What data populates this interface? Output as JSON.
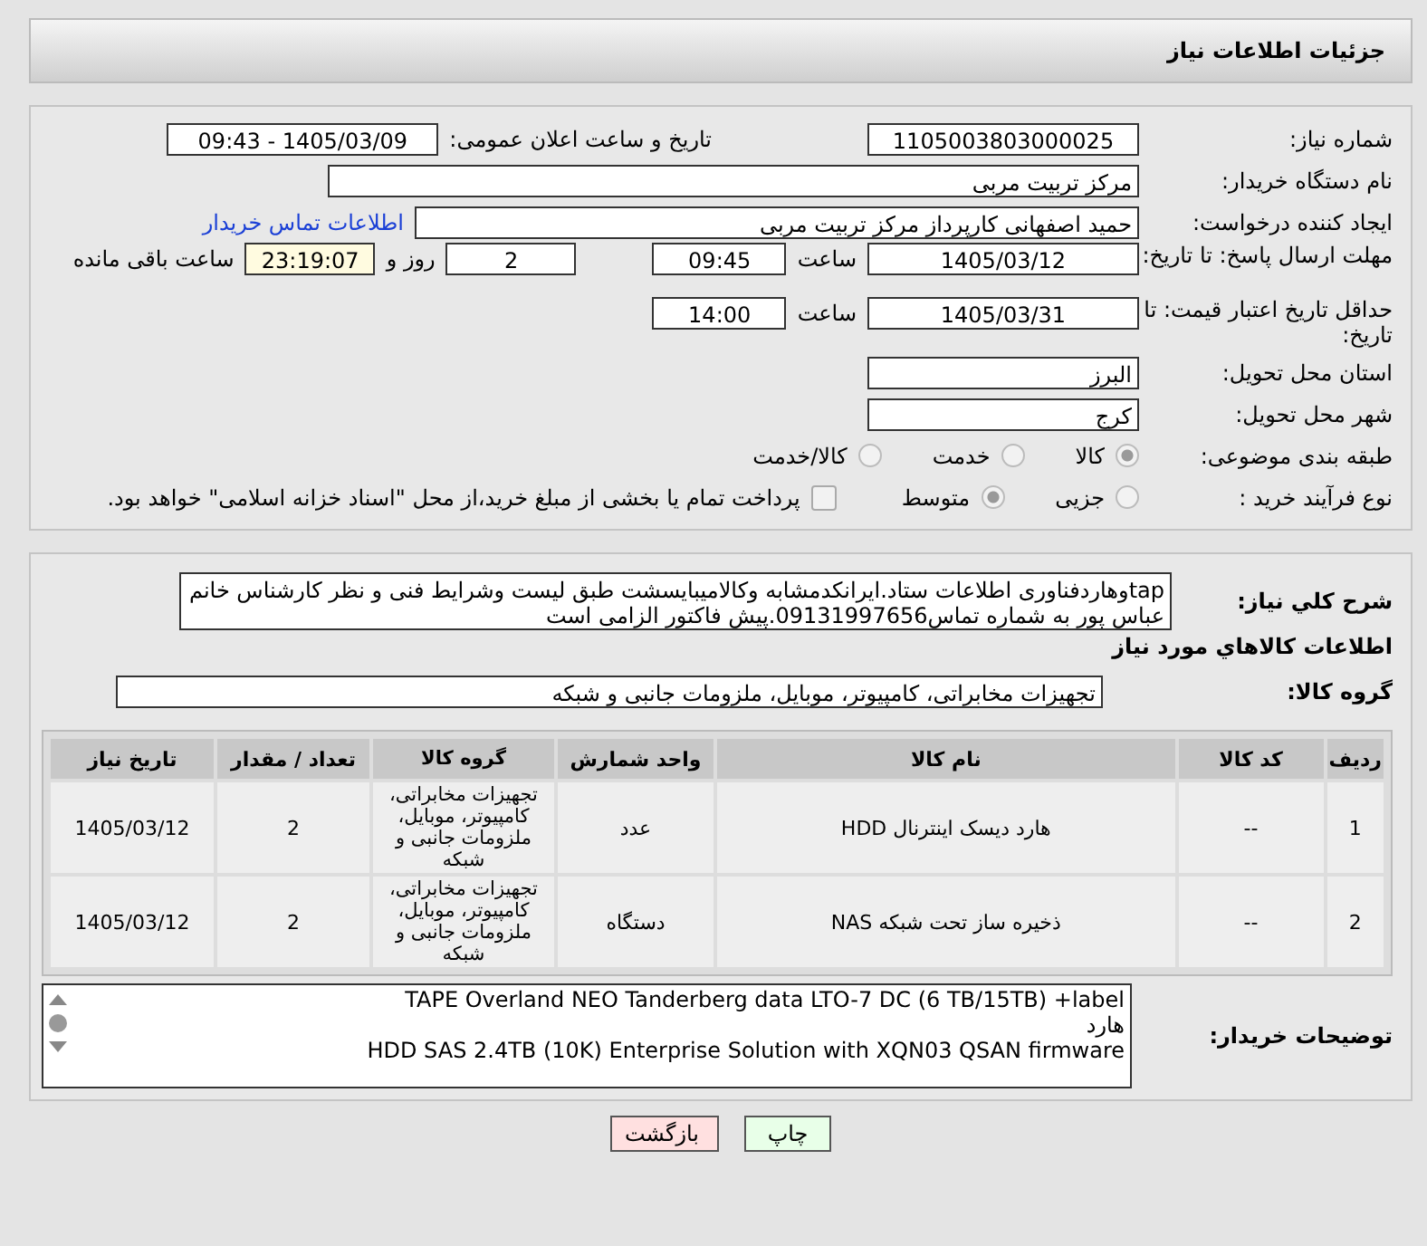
{
  "header": {
    "title": "جزئیات اطلاعات نیاز"
  },
  "need_number": {
    "label": "شماره نیاز:",
    "value": "1105003803000025"
  },
  "announce": {
    "label": "تاریخ و ساعت اعلان عمومی:",
    "value": "1405/03/09 - 09:43"
  },
  "buyer": {
    "label": "نام دستگاه خریدار:",
    "value": "مرکز تربیت مربی"
  },
  "requester": {
    "label": "ایجاد کننده درخواست:",
    "value": "حمید اصفهانی کارپرداز مرکز تربیت مربی",
    "link": "اطلاعات تماس خریدار"
  },
  "deadline": {
    "label": "مهلت ارسال پاسخ: تا تاریخ:",
    "date": "1405/03/12",
    "time_label": "ساعت",
    "time": "09:45",
    "days": "2",
    "days_label": "روز و",
    "remaining": "23:19:07",
    "remaining_label": "ساعت باقی مانده"
  },
  "validity": {
    "label": "حداقل تاریخ اعتبار قیمت: تا تاریخ:",
    "date": "1405/03/31",
    "time_label": "ساعت",
    "time": "14:00"
  },
  "province": {
    "label": "استان محل تحویل:",
    "value": "البرز"
  },
  "city": {
    "label": "شهر محل تحویل:",
    "value": "کرج"
  },
  "category": {
    "label": "طبقه بندی موضوعی:",
    "options": [
      {
        "label": "کالا",
        "selected": true
      },
      {
        "label": "خدمت",
        "selected": false
      },
      {
        "label": "کالا/خدمت",
        "selected": false
      }
    ]
  },
  "process": {
    "label": "نوع فرآیند خرید :",
    "options": [
      {
        "label": "جزیی",
        "selected": false
      },
      {
        "label": "متوسط",
        "selected": true
      }
    ],
    "payment": {
      "label": "پرداخت تمام یا بخشی از مبلغ خرید،از محل \"اسناد خزانه اسلامی\" خواهد بود.",
      "checked": false
    }
  },
  "description": {
    "label": "شرح کلي نياز:",
    "value": "tapوهاردفناوری اطلاعات ستاد.ایرانکدمشابه وکالامیبایسشت طبق لیست وشرایط فنی و نظر کارشناس خانم عباس پور به شماره تماس09131997656.پیش فاکتور الزامی است"
  },
  "goods": {
    "title": "اطلاعات کالاهاي مورد نياز",
    "group_label": "گروه کالا:",
    "group": "تجهیزات مخابراتی، کامپیوتر، موبایل، ملزومات جانبی و شبکه",
    "columns": [
      "ردیف",
      "کد کالا",
      "نام کالا",
      "واحد شمارش",
      "گروه کالا",
      "تعداد / مقدار",
      "تاریخ نیاز"
    ],
    "rows": [
      [
        "1",
        "--",
        "هارد دیسک اینترنال HDD",
        "عدد",
        "تجهیزات مخابراتی، کامپیوتر، موبایل، ملزومات جانبی و شبکه",
        "2",
        "1405/03/12"
      ],
      [
        "2",
        "--",
        "ذخیره ساز تحت شبکه NAS",
        "دستگاه",
        "تجهیزات مخابراتی، کامپیوتر، موبایل، ملزومات جانبی و شبکه",
        "2",
        "1405/03/12"
      ]
    ]
  },
  "buyer_notes": {
    "label": "توضیحات خریدار:",
    "lines": [
      "TAPE Overland NEO Tanderberg data LTO-7 DC (6 TB/15TB) +label",
      "هارد",
      "HDD SAS 2.4TB (10K) Enterprise Solution with XQN03 QSAN firmware"
    ]
  },
  "buttons": [
    {
      "label": "چاپ",
      "kind": "print"
    },
    {
      "label": "بازگشت",
      "kind": "back"
    }
  ]
}
